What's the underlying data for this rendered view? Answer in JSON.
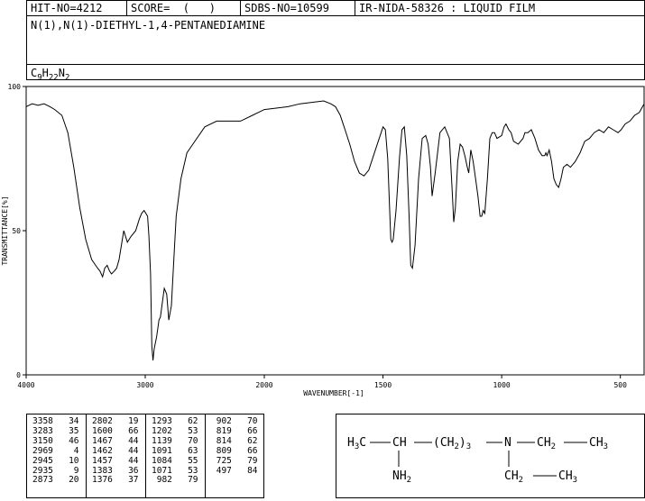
{
  "header": {
    "hit_no": "HIT-NO=4212",
    "score": "SCORE=  (   )",
    "sdbs_no": "SDBS-NO=10599",
    "ir_info": "IR-NIDA-58326 : LIQUID FILM",
    "compound_name": "N(1),N(1)-DIETHYL-1,4-PENTANEDIAMINE",
    "formula": {
      "c": "C",
      "c_n": "9",
      "h": "H",
      "h_n": "22",
      "n": "N",
      "n_n": "2"
    }
  },
  "chart_data": {
    "type": "line",
    "xlabel": "WAVENUMBER[-1]",
    "ylabel": "TRANSMITTANCE[%]",
    "xlim": [
      4000,
      400
    ],
    "ylim": [
      0,
      100
    ],
    "x_ticks": [
      "4000",
      "3000",
      "2000",
      "1500",
      "1000",
      "500"
    ],
    "y_ticks": [
      "100",
      "50",
      "0"
    ],
    "x": [
      4000,
      3950,
      3900,
      3850,
      3800,
      3760,
      3700,
      3650,
      3600,
      3550,
      3500,
      3450,
      3400,
      3380,
      3358,
      3340,
      3320,
      3300,
      3283,
      3260,
      3240,
      3220,
      3200,
      3180,
      3150,
      3120,
      3080,
      3050,
      3030,
      3010,
      2995,
      2980,
      2969,
      2955,
      2945,
      2935,
      2925,
      2915,
      2905,
      2895,
      2885,
      2873,
      2860,
      2840,
      2820,
      2802,
      2780,
      2760,
      2740,
      2700,
      2650,
      2600,
      2500,
      2400,
      2300,
      2200,
      2100,
      2000,
      1950,
      1900,
      1850,
      1800,
      1750,
      1720,
      1700,
      1680,
      1660,
      1640,
      1620,
      1600,
      1580,
      1560,
      1540,
      1520,
      1500,
      1490,
      1480,
      1467,
      1462,
      1457,
      1445,
      1430,
      1420,
      1410,
      1400,
      1390,
      1383,
      1376,
      1365,
      1350,
      1335,
      1320,
      1310,
      1300,
      1293,
      1280,
      1260,
      1240,
      1220,
      1210,
      1202,
      1195,
      1185,
      1175,
      1165,
      1155,
      1145,
      1139,
      1130,
      1120,
      1110,
      1100,
      1091,
      1084,
      1078,
      1071,
      1060,
      1050,
      1040,
      1030,
      1020,
      1000,
      990,
      982,
      970,
      960,
      950,
      930,
      910,
      902,
      890,
      875,
      860,
      845,
      830,
      819,
      814,
      809,
      800,
      790,
      780,
      770,
      760,
      750,
      740,
      725,
      710,
      690,
      670,
      650,
      630,
      610,
      590,
      570,
      550,
      530,
      510,
      497,
      480,
      460,
      440,
      420,
      400
    ],
    "y": [
      93,
      94,
      93.5,
      94,
      93,
      92,
      90,
      84,
      72,
      58,
      47,
      40,
      37,
      36,
      34,
      37,
      38,
      36,
      35,
      36,
      37,
      40,
      45,
      50,
      46,
      48,
      50,
      54,
      56,
      57,
      56,
      55,
      48,
      35,
      10,
      5,
      9,
      11,
      13,
      16,
      19,
      20,
      24,
      30,
      28,
      19,
      24,
      40,
      55,
      68,
      77,
      80,
      86,
      88,
      88,
      88,
      90,
      92,
      92.5,
      93,
      94,
      94.5,
      95,
      94,
      93,
      90,
      85,
      80,
      74,
      70,
      69,
      71,
      76,
      81,
      86,
      85,
      75,
      47,
      46,
      47,
      57,
      76,
      85,
      86,
      76,
      55,
      38,
      37,
      45,
      68,
      82,
      83,
      80,
      72,
      62,
      70,
      84,
      86,
      82,
      66,
      53,
      58,
      74,
      80,
      79,
      76,
      72,
      70,
      78,
      74,
      68,
      62,
      55,
      55,
      57,
      56,
      68,
      82,
      84,
      84,
      82,
      83,
      86,
      87,
      85,
      84,
      81,
      80,
      82,
      84,
      84,
      85,
      82,
      78,
      76,
      76,
      77,
      76,
      78,
      74,
      68,
      66,
      65,
      68,
      72,
      73,
      72,
      74,
      77,
      81,
      82,
      84,
      85,
      84,
      86,
      85,
      84,
      85,
      87,
      88,
      90,
      91,
      94,
      95,
      92,
      90,
      91,
      89
    ]
  },
  "peaks": [
    [
      "3358",
      "34"
    ],
    [
      "3283",
      "35"
    ],
    [
      "3150",
      "46"
    ],
    [
      "2969",
      "4"
    ],
    [
      "2945",
      "10"
    ],
    [
      "2935",
      "9"
    ],
    [
      "2873",
      "20"
    ],
    [
      "2802",
      "19"
    ],
    [
      "1600",
      "66"
    ],
    [
      "1467",
      "44"
    ],
    [
      "1462",
      "44"
    ],
    [
      "1457",
      "44"
    ],
    [
      "1383",
      "36"
    ],
    [
      "1376",
      "37"
    ],
    [
      "1293",
      "62"
    ],
    [
      "1202",
      "53"
    ],
    [
      "1139",
      "70"
    ],
    [
      "1091",
      "63"
    ],
    [
      "1084",
      "55"
    ],
    [
      "1071",
      "53"
    ],
    [
      "982",
      "79"
    ],
    [
      "902",
      "70"
    ],
    [
      "819",
      "66"
    ],
    [
      "814",
      "62"
    ],
    [
      "809",
      "66"
    ],
    [
      "725",
      "79"
    ],
    [
      "497",
      "84"
    ]
  ],
  "structure": {
    "h3c": "H",
    "h3c_3": "3",
    "h3c_c": "C",
    "ch": "CH",
    "ch2_group": "(CH",
    "ch2_2": "2",
    "paren_close": ")",
    "sub_3": "3",
    "n": "N",
    "ch2_a": "CH",
    "ch2_a_2": "2",
    "ch3_a": "CH",
    "ch3_a_3": "3",
    "nh2": "NH",
    "nh2_2": "2",
    "ch2_b": "CH",
    "ch2_b_2": "2",
    "ch3_b": "CH",
    "ch3_b_3": "3"
  }
}
